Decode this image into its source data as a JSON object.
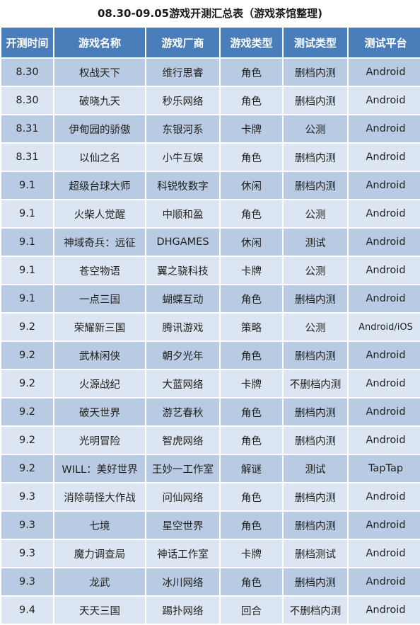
{
  "document": {
    "title": "08.30-09.05游戏开测汇总表（游戏茶馆整理)"
  },
  "table": {
    "columns": [
      {
        "key": "date",
        "label": "开测时间"
      },
      {
        "key": "name",
        "label": "游戏名称"
      },
      {
        "key": "vendor",
        "label": "游戏厂商"
      },
      {
        "key": "genre",
        "label": "游戏类型"
      },
      {
        "key": "test_type",
        "label": "测试类型"
      },
      {
        "key": "platform",
        "label": "测试平台"
      }
    ],
    "colors": {
      "header_bg": "#4a7ebb",
      "header_text": "#ffffff",
      "row_dark_bg": "#b9cbe2",
      "row_light_bg": "#dce6f2",
      "body_text": "#1f1f1f",
      "page_bg": "#ffffff"
    },
    "rows": [
      {
        "date": "8.30",
        "name": "权战天下",
        "vendor": "维行思睿",
        "genre": "角色",
        "test_type": "删档内测",
        "platform": "Android"
      },
      {
        "date": "8.30",
        "name": "破晓九天",
        "vendor": "秒乐网络",
        "genre": "角色",
        "test_type": "删档内测",
        "platform": "Android"
      },
      {
        "date": "8.31",
        "name": "伊甸园的骄傲",
        "vendor": "东银河系",
        "genre": "卡牌",
        "test_type": "公测",
        "platform": "Android"
      },
      {
        "date": "8.31",
        "name": "以仙之名",
        "vendor": "小牛互娱",
        "genre": "角色",
        "test_type": "删档内测",
        "platform": "Android"
      },
      {
        "date": "9.1",
        "name": "超级台球大师",
        "vendor": "科锐牧数字",
        "genre": "休闲",
        "test_type": "删档内测",
        "platform": "Android"
      },
      {
        "date": "9.1",
        "name": "火柴人觉醒",
        "vendor": "中顺和盈",
        "genre": "角色",
        "test_type": "公测",
        "platform": "Android"
      },
      {
        "date": "9.1",
        "name": "神域奇兵：远征",
        "vendor": "DHGAMES",
        "genre": "休闲",
        "test_type": "测试",
        "platform": "Android"
      },
      {
        "date": "9.1",
        "name": "苍空物语",
        "vendor": "翼之骁科技",
        "genre": "卡牌",
        "test_type": "公测",
        "platform": "Android"
      },
      {
        "date": "9.1",
        "name": "一点三国",
        "vendor": "蝴蝶互动",
        "genre": "角色",
        "test_type": "删档内测",
        "platform": "Android"
      },
      {
        "date": "9.2",
        "name": "荣耀新三国",
        "vendor": "腾讯游戏",
        "genre": "策略",
        "test_type": "公测",
        "platform": "Android/iOS"
      },
      {
        "date": "9.2",
        "name": "武林闲侠",
        "vendor": "朝夕光年",
        "genre": "角色",
        "test_type": "删档内测",
        "platform": "Android"
      },
      {
        "date": "9.2",
        "name": "火源战纪",
        "vendor": "大蓝网络",
        "genre": "卡牌",
        "test_type": "不删档内测",
        "platform": "Android"
      },
      {
        "date": "9.2",
        "name": "破天世界",
        "vendor": "游艺春秋",
        "genre": "角色",
        "test_type": "删档内测",
        "platform": "Android"
      },
      {
        "date": "9.2",
        "name": "光明冒险",
        "vendor": "智虎网络",
        "genre": "角色",
        "test_type": "删档内测",
        "platform": "Android"
      },
      {
        "date": "9.2",
        "name": "WILL：美好世界",
        "vendor": "王妙一工作室",
        "genre": "解谜",
        "test_type": "测试",
        "platform": "TapTap"
      },
      {
        "date": "9.3",
        "name": "消除萌怪大作战",
        "vendor": "问仙网络",
        "genre": "角色",
        "test_type": "删档内测",
        "platform": "Android"
      },
      {
        "date": "9.3",
        "name": "七境",
        "vendor": "星空世界",
        "genre": "角色",
        "test_type": "删档内测",
        "platform": "Android"
      },
      {
        "date": "9.3",
        "name": "魔力调查局",
        "vendor": "神话工作室",
        "genre": "卡牌",
        "test_type": "删档测试",
        "platform": "Android"
      },
      {
        "date": "9.3",
        "name": "龙武",
        "vendor": "冰川网络",
        "genre": "角色",
        "test_type": "删档内测",
        "platform": "Android"
      },
      {
        "date": "9.4",
        "name": "天天三国",
        "vendor": "踢扑网络",
        "genre": "回合",
        "test_type": "不删档内测",
        "platform": "Android"
      }
    ]
  }
}
